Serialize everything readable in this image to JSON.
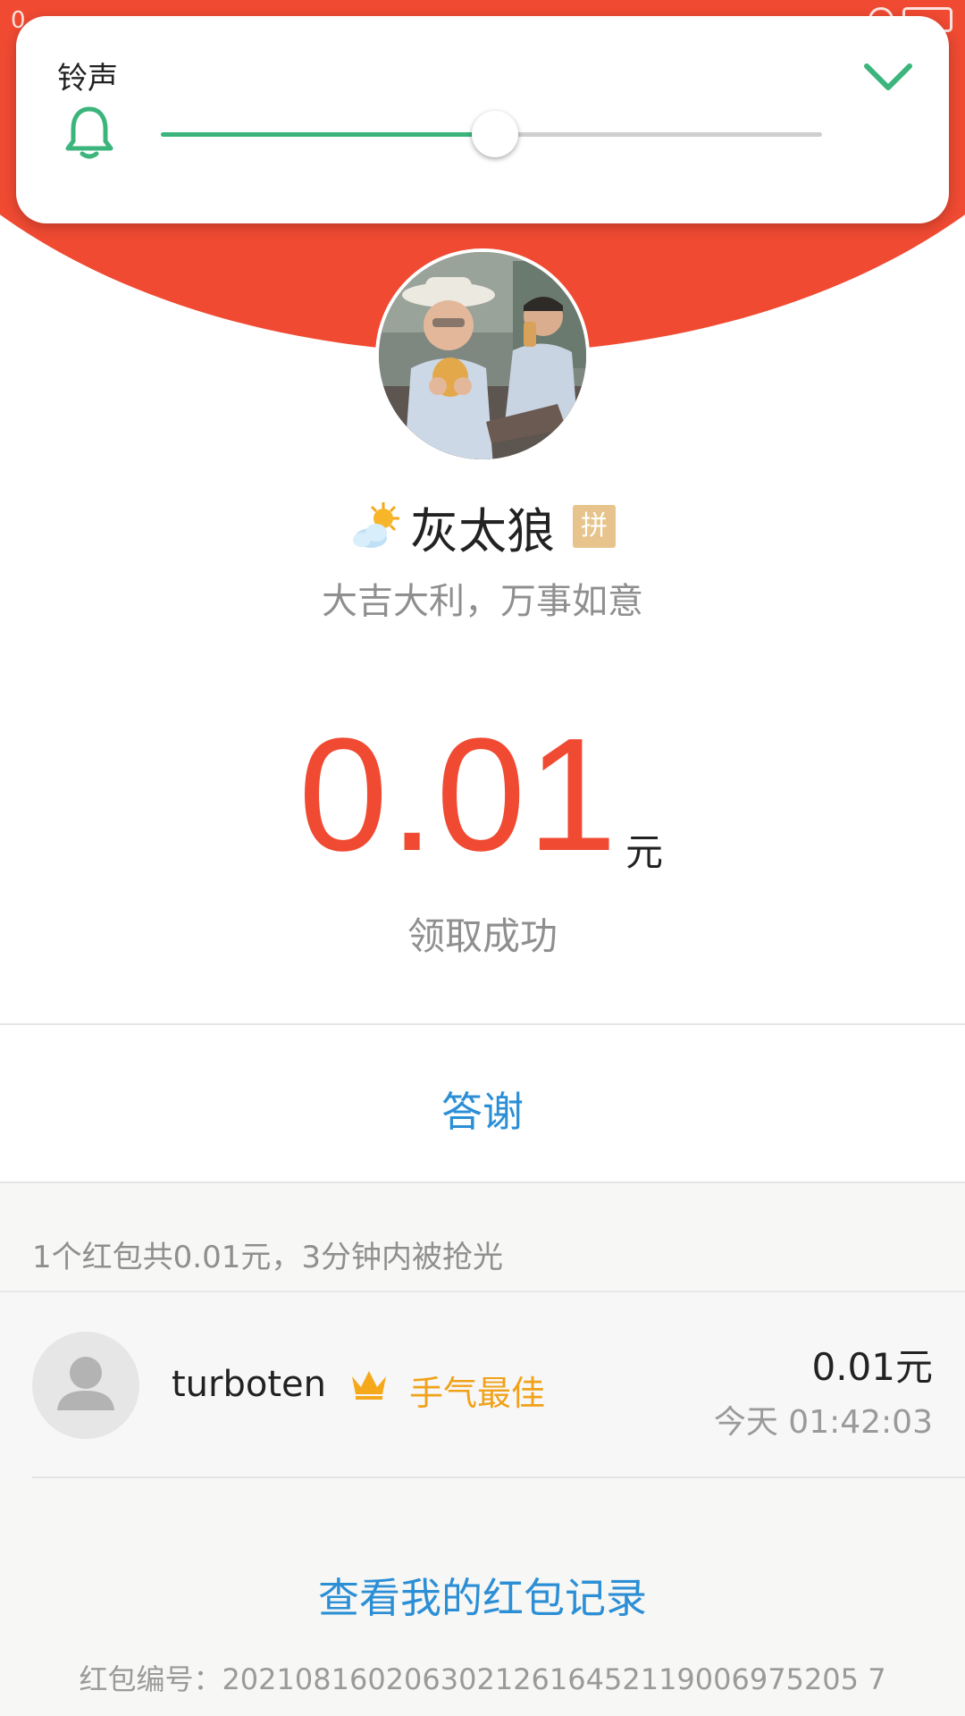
{
  "status_bar": {
    "left_text": "0"
  },
  "volume_panel": {
    "title": "铃声",
    "level_fraction": 0.505,
    "accent_color": "#3bb57c",
    "icon": "bell-icon",
    "collapse_icon": "chevron-down-icon"
  },
  "sender": {
    "weather_icon": "partly-sunny-icon",
    "name": "灰太狼",
    "badge": "拼",
    "greeting": "大吉大利，万事如意"
  },
  "amount": {
    "value": "0.01",
    "unit": "元",
    "status": "领取成功",
    "color": "#f04a32"
  },
  "reply_label": "答谢",
  "summary": "1个红包共0.01元，3分钟内被抢光",
  "records": [
    {
      "name": "turboten",
      "badge_icon": "crown-icon",
      "badge_label": "手气最佳",
      "amount": "0.01元",
      "time": "今天 01:42:03"
    }
  ],
  "history_link": "查看我的红包记录",
  "packet_id": "红包编号：20210816020630212616452119006975205 7"
}
